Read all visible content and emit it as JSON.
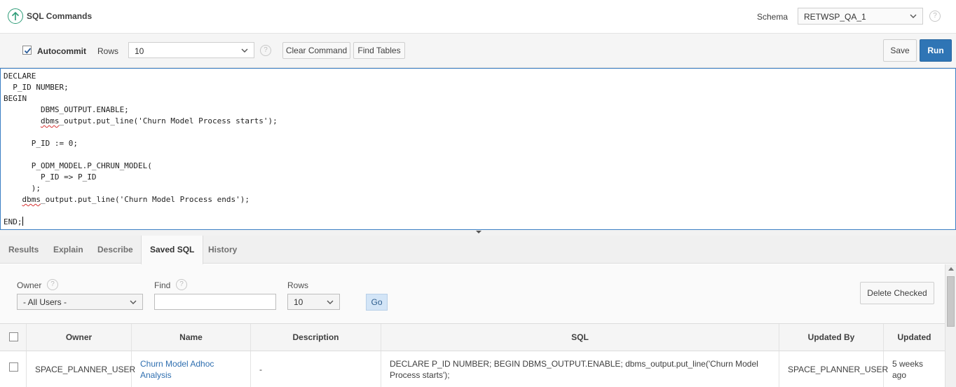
{
  "header": {
    "title": "SQL Commands",
    "back_icon": "arrow-up-circle-icon",
    "schema_label": "Schema",
    "schema_value": "RETWSP_QA_1",
    "help_glyph": "?"
  },
  "toolbar": {
    "autocommit_label": "Autocommit",
    "autocommit_checked": true,
    "rows_label": "Rows",
    "rows_value": "10",
    "clear_label": "Clear Command",
    "find_tables_label": "Find Tables",
    "save_label": "Save",
    "run_label": "Run"
  },
  "editor": {
    "lines": [
      "DECLARE",
      "  P_ID NUMBER;",
      "BEGIN",
      "        DBMS_OUTPUT.ENABLE;",
      "        dbms_output.put_line('Churn Model Process starts');",
      "",
      "      P_ID := 0;",
      "",
      "      P_ODM_MODEL.P_CHRUN_MODEL(",
      "        P_ID => P_ID",
      "      );",
      "    dbms_output.put_line('Churn Model Process ends');",
      "",
      "END;"
    ]
  },
  "tabs": [
    {
      "label": "Results"
    },
    {
      "label": "Explain"
    },
    {
      "label": "Describe"
    },
    {
      "label": "Saved SQL"
    },
    {
      "label": "History"
    }
  ],
  "active_tab": "Saved SQL",
  "saved_sql": {
    "owner_label": "Owner",
    "owner_value": "- All Users -",
    "find_label": "Find",
    "find_value": "",
    "rows_label": "Rows",
    "rows_value": "10",
    "go_label": "Go",
    "delete_label": "Delete Checked",
    "columns": [
      "Owner",
      "Name",
      "Description",
      "SQL",
      "Updated By",
      "Updated"
    ],
    "rows": [
      {
        "owner": "SPACE_PLANNER_USER",
        "name": "Churn Model Adhoc Analysis",
        "description": "-",
        "sql": "DECLARE P_ID NUMBER; BEGIN DBMS_OUTPUT.ENABLE; dbms_output.put_line('Churn Model Process starts');",
        "updated_by": "SPACE_PLANNER_USER",
        "updated": "5 weeks ago"
      }
    ]
  },
  "colors": {
    "accent": "#2f75b5",
    "link": "#2f6fb0",
    "icon_green": "#2e9c78"
  }
}
